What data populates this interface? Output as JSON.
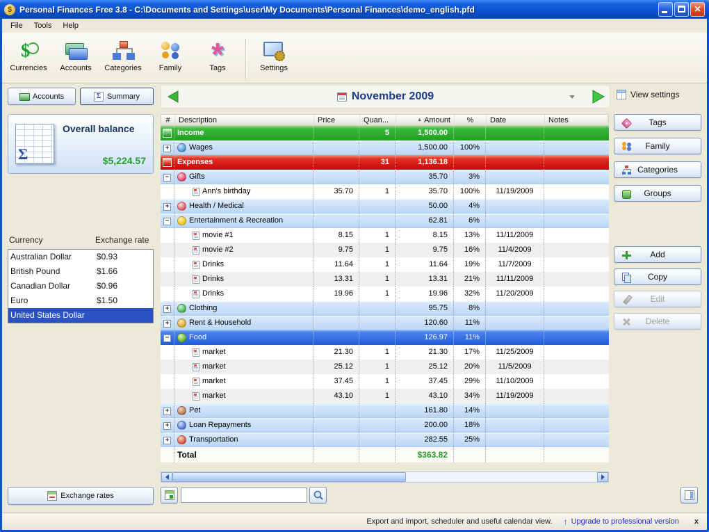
{
  "window": {
    "title": "Personal Finances Free 3.8 - C:\\Documents and Settings\\user\\My Documents\\Personal Finances\\demo_english.pfd"
  },
  "menu": {
    "items": [
      "File",
      "Tools",
      "Help"
    ]
  },
  "toolbar": {
    "items": [
      {
        "label": "Currencies",
        "icon": "currencies-icon"
      },
      {
        "label": "Accounts",
        "icon": "accounts-icon"
      },
      {
        "label": "Categories",
        "icon": "categories-icon"
      },
      {
        "label": "Family",
        "icon": "family-icon"
      },
      {
        "label": "Tags",
        "icon": "tags-icon"
      },
      {
        "label": "Settings",
        "icon": "settings-icon"
      }
    ]
  },
  "subnav": {
    "accounts": "Accounts",
    "summary": "Summary",
    "period": "November 2009",
    "view_settings": "View settings"
  },
  "left_panel": {
    "balance_title": "Overall balance",
    "balance_value": "$5,224.57",
    "currency_header": "Currency",
    "rate_header": "Exchange rate",
    "currencies": [
      {
        "name": "Australian Dollar",
        "rate": "$0.93",
        "selected": false
      },
      {
        "name": "British Pound",
        "rate": "$1.66",
        "selected": false
      },
      {
        "name": "Canadian Dollar",
        "rate": "$0.96",
        "selected": false
      },
      {
        "name": "Euro",
        "rate": "$1.50",
        "selected": false
      },
      {
        "name": "United States Dollar",
        "rate": "",
        "selected": true
      }
    ],
    "exchange_rates_label": "Exchange rates"
  },
  "grid": {
    "columns": [
      "#",
      "Description",
      "Price",
      "Quan...",
      "Amount",
      "%",
      "Date",
      "Notes"
    ],
    "sort_column": "Amount",
    "rows": [
      {
        "type": "income",
        "desc": "Income",
        "qty": "5",
        "amount": "1,500.00"
      },
      {
        "type": "category",
        "expand": "+",
        "icon": "wages-icon",
        "desc": "Wages",
        "amount": "1,500.00",
        "pct": "100%"
      },
      {
        "type": "expenses",
        "desc": "Expenses",
        "qty": "31",
        "amount": "1,136.18"
      },
      {
        "type": "category",
        "expand": "-",
        "icon": "gifts-icon",
        "desc": "Gifts",
        "amount": "35.70",
        "pct": "3%"
      },
      {
        "type": "item",
        "icon": "record-icon",
        "desc": "Ann's birthday",
        "price": "35.70",
        "qty": "1",
        "amount": "35.70",
        "pct": "100%",
        "date": "11/19/2009"
      },
      {
        "type": "category",
        "expand": "+",
        "icon": "health-icon",
        "desc": "Health / Medical",
        "amount": "50.00",
        "pct": "4%"
      },
      {
        "type": "category",
        "expand": "-",
        "icon": "entertainment-icon",
        "desc": "Entertainment & Recreation",
        "amount": "62.81",
        "pct": "6%"
      },
      {
        "type": "item",
        "icon": "record-icon",
        "desc": "movie #1",
        "price": "8.15",
        "qty": "1",
        "amount": "8.15",
        "pct": "13%",
        "date": "11/11/2009"
      },
      {
        "type": "item",
        "icon": "record-icon",
        "desc": "movie #2",
        "price": "9.75",
        "qty": "1",
        "amount": "9.75",
        "pct": "16%",
        "date": "11/4/2009"
      },
      {
        "type": "item",
        "icon": "record-icon",
        "desc": "Drinks",
        "price": "11.64",
        "qty": "1",
        "amount": "11.64",
        "pct": "19%",
        "date": "11/7/2009"
      },
      {
        "type": "item",
        "icon": "record-icon",
        "desc": "Drinks",
        "price": "13.31",
        "qty": "1",
        "amount": "13.31",
        "pct": "21%",
        "date": "11/11/2009"
      },
      {
        "type": "item",
        "icon": "record-icon",
        "desc": "Drinks",
        "price": "19.96",
        "qty": "1",
        "amount": "19.96",
        "pct": "32%",
        "date": "11/20/2009"
      },
      {
        "type": "category",
        "expand": "+",
        "icon": "clothing-icon",
        "desc": "Clothing",
        "amount": "95.75",
        "pct": "8%"
      },
      {
        "type": "category",
        "expand": "+",
        "icon": "rent-icon",
        "desc": "Rent & Household",
        "amount": "120.60",
        "pct": "11%"
      },
      {
        "type": "category",
        "expand": "-",
        "icon": "food-icon",
        "desc": "Food",
        "amount": "126.97",
        "pct": "11%",
        "selected": true
      },
      {
        "type": "item",
        "icon": "record-icon",
        "desc": "market",
        "price": "21.30",
        "qty": "1",
        "amount": "21.30",
        "pct": "17%",
        "date": "11/25/2009"
      },
      {
        "type": "item",
        "icon": "record-icon",
        "desc": "market",
        "price": "25.12",
        "qty": "1",
        "amount": "25.12",
        "pct": "20%",
        "date": "11/5/2009"
      },
      {
        "type": "item",
        "icon": "record-icon",
        "desc": "market",
        "price": "37.45",
        "qty": "1",
        "amount": "37.45",
        "pct": "29%",
        "date": "11/10/2009"
      },
      {
        "type": "item",
        "icon": "record-icon",
        "desc": "market",
        "price": "43.10",
        "qty": "1",
        "amount": "43.10",
        "pct": "34%",
        "date": "11/19/2009"
      },
      {
        "type": "category",
        "expand": "+",
        "icon": "pet-icon",
        "desc": "Pet",
        "amount": "161.80",
        "pct": "14%"
      },
      {
        "type": "category",
        "expand": "+",
        "icon": "loan-icon",
        "desc": "Loan Repayments",
        "amount": "200.00",
        "pct": "18%"
      },
      {
        "type": "category",
        "expand": "+",
        "icon": "transport-icon",
        "desc": "Transportation",
        "amount": "282.55",
        "pct": "25%"
      }
    ],
    "total_label": "Total",
    "total_value": "$363.82"
  },
  "right_panel": {
    "view_buttons": [
      {
        "label": "Tags",
        "icon": "tags-icon"
      },
      {
        "label": "Family",
        "icon": "family-icon"
      },
      {
        "label": "Categories",
        "icon": "categories-icon"
      },
      {
        "label": "Groups",
        "icon": "groups-icon"
      }
    ],
    "action_buttons": [
      {
        "label": "Add",
        "icon": "add-icon",
        "enabled": true
      },
      {
        "label": "Copy",
        "icon": "copy-icon",
        "enabled": true
      },
      {
        "label": "Edit",
        "icon": "edit-icon",
        "enabled": false
      },
      {
        "label": "Delete",
        "icon": "delete-icon",
        "enabled": false
      }
    ]
  },
  "bottom_bar": {
    "search_value": ""
  },
  "status_bar": {
    "message": "Export and import, scheduler and useful calendar view.",
    "link": "Upgrade to professional version",
    "close": "x"
  },
  "colors": {
    "income_green": "#1f9e1f",
    "expenses_red": "#c80808",
    "selection_blue": "#1f5cd8",
    "balance_green": "#23a02a",
    "link_blue": "#1f2fb8"
  }
}
